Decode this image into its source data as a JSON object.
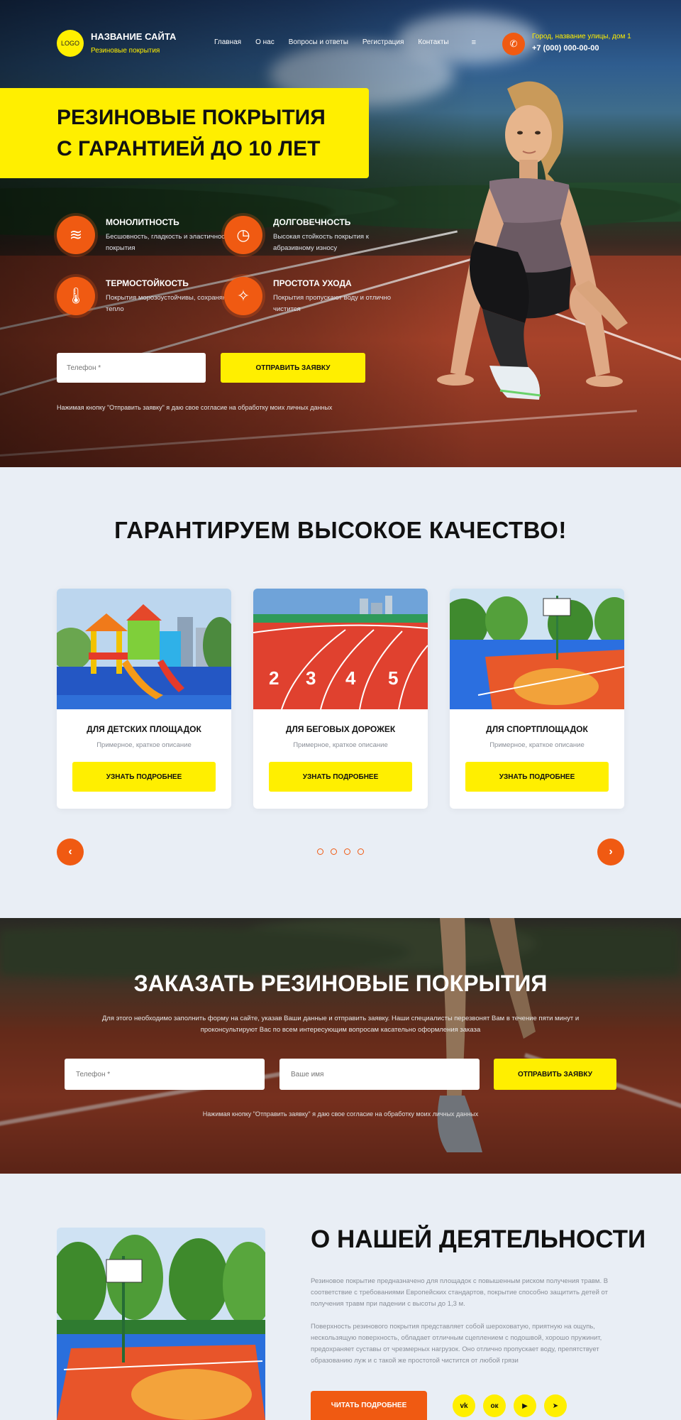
{
  "header": {
    "logo_text": "LOGO",
    "site_name": "НАЗВАНИЕ САЙТА",
    "site_sub": "Резиновые покрытия",
    "nav": [
      "Главная",
      "О нас",
      "Вопросы и ответы",
      "Регистрация",
      "Контакты"
    ],
    "menu_icon": "≡",
    "phone_icon": "✆",
    "address": "Город, название улицы, дом 1",
    "phone": "+7 (000) 000-00-00"
  },
  "hero": {
    "title_line1": "РЕЗИНОВЫЕ ПОКРЫТИЯ",
    "title_line2": "С ГАРАНТИЕЙ ДО 10 ЛЕТ",
    "features": [
      {
        "icon": "layers-icon",
        "glyph": "≋",
        "title": "МОНОЛИТНОСТЬ",
        "text": "Бесшовность, гладкость и эластичность покрытия"
      },
      {
        "icon": "clock-icon",
        "glyph": "◷",
        "title": "ДОЛГОВЕЧНОСТЬ",
        "text": "Высокая стойкость покрытия к абразивному износу"
      },
      {
        "icon": "thermometer-icon",
        "glyph": "🌡",
        "title": "ТЕРМОСТОЙКОСТЬ",
        "text": "Покрытия морозоустойчивы, сохраняют тепло"
      },
      {
        "icon": "broom-icon",
        "glyph": "✧",
        "title": "ПРОСТОТА УХОДА",
        "text": "Покрытия пропускают воду и отлично чистится"
      }
    ],
    "phone_placeholder": "Телефон *",
    "submit_label": "ОТПРАВИТЬ ЗАЯВКУ",
    "consent": "Нажимая кнопку \"Отправить заявку\" я даю свое согласие на обработку моих личных данных"
  },
  "quality": {
    "title": "ГАРАНТИРУЕМ ВЫСОКОЕ КАЧЕСТВО!",
    "cards": [
      {
        "title": "ДЛЯ ДЕТСКИХ ПЛОЩАДОК",
        "desc": "Примерное, краткое описание",
        "button": "УЗНАТЬ ПОДРОБНЕЕ"
      },
      {
        "title": "ДЛЯ БЕГОВЫХ ДОРОЖЕК",
        "desc": "Примерное, краткое описание",
        "button": "УЗНАТЬ ПОДРОБНЕЕ"
      },
      {
        "title": "ДЛЯ СПОРТПЛОЩАДОК",
        "desc": "Примерное, краткое описание",
        "button": "УЗНАТЬ ПОДРОБНЕЕ"
      }
    ],
    "track_numbers": [
      "2",
      "3",
      "4",
      "5"
    ],
    "prev_icon": "‹",
    "next_icon": "›",
    "dots_count": 4
  },
  "order": {
    "title": "ЗАКАЗАТЬ РЕЗИНОВЫЕ ПОКРЫТИЯ",
    "text": "Для этого необходимо заполнить форму на сайте, указав Ваши данные и отправить заявку. Наши специалисты перезвонят Вам в течение пяти минут и проконсультируют Вас по всем интересующим вопросам касательно оформления заказа",
    "phone_placeholder": "Телефон *",
    "name_placeholder": "Ваше имя",
    "submit_label": "ОТПРАВИТЬ ЗАЯВКУ",
    "consent": "Нажимая кнопку \"Отправить заявку\" я даю свое согласие на обработку моих личных данных"
  },
  "about": {
    "title": "О НАШЕЙ ДЕЯТЕЛЬНОСТИ",
    "p1": "Резиновое покрытие предназначено для площадок с повышенным риском получения травм. В соответствие с требованиями Европейских стандартов, покрытие способно защитить детей от получения травм при падении с высоты до 1,3 м.",
    "p2": "Поверхность резинового покрытия представляет собой шероховатую, приятную на ощупь, нескользящую поверхность, обладает отличным сцеплением с подошвой, хорошо пружинит, предохраняет суставы от чрезмерных нагрузок. Оно отлично пропускает воду, препятствует образованию луж и с такой же простотой чистится от любой грязи",
    "button": "ЧИТАТЬ ПОДРОБНЕЕ",
    "socials": [
      {
        "name": "vk-icon",
        "glyph": "vk"
      },
      {
        "name": "odnoklassniki-icon",
        "glyph": "ок"
      },
      {
        "name": "youtube-icon",
        "glyph": "▶"
      },
      {
        "name": "telegram-icon",
        "glyph": "➤"
      }
    ]
  },
  "colors": {
    "accent": "#ffef00",
    "orange": "#f05a12",
    "bg": "#e9eef5"
  }
}
